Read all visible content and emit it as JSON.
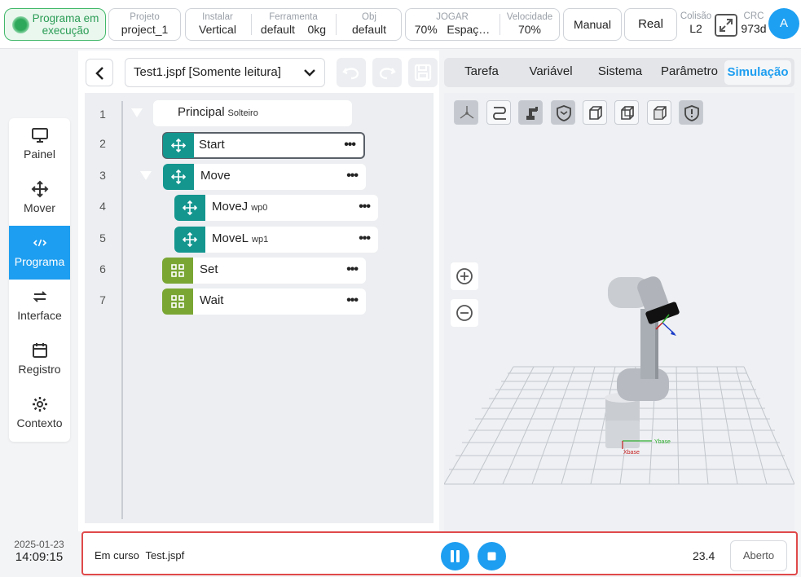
{
  "status": {
    "label": "Programa em execução",
    "color": "#2a9c55"
  },
  "header": {
    "project": {
      "label": "Projeto",
      "value": "project_1"
    },
    "install": {
      "label": "Instalar",
      "value": "Vertical"
    },
    "tool": {
      "label": "Ferramenta",
      "value": "default",
      "weight": "0kg"
    },
    "obj": {
      "label": "Obj",
      "value": "default"
    },
    "jog": {
      "label": "JOGAR",
      "value": "70%",
      "space": "Espaç…"
    },
    "speed": {
      "label": "Velocidade",
      "value": "70%"
    },
    "mode_manual": "Manual",
    "mode_real": "Real",
    "collision": {
      "label": "Colisão",
      "value": "L2"
    },
    "crc": {
      "label": "CRC",
      "value": "973d"
    },
    "avatar": "A"
  },
  "nav": {
    "items": [
      {
        "label": "Painel",
        "icon": "monitor-icon"
      },
      {
        "label": "Mover",
        "icon": "move-arrows-icon"
      },
      {
        "label": "Programa",
        "icon": "code-icon"
      },
      {
        "label": "Interface",
        "icon": "swap-icon"
      },
      {
        "label": "Registro",
        "icon": "calendar-icon"
      },
      {
        "label": "Contexto",
        "icon": "gear-icon"
      }
    ],
    "active": "Programa"
  },
  "datetime": {
    "date": "2025-01-23",
    "time": "14:09:15"
  },
  "editor": {
    "file": "Test1.jspf [Somente leitura]",
    "tree": [
      {
        "line": "1",
        "label": "Principal",
        "sub": "Solteiro",
        "type": "root"
      },
      {
        "line": "2",
        "label": "Start",
        "sub": "",
        "type": "move",
        "selected": true
      },
      {
        "line": "3",
        "label": "Move",
        "sub": "",
        "type": "move"
      },
      {
        "line": "4",
        "label": "MoveJ",
        "sub": "wp0",
        "type": "move"
      },
      {
        "line": "5",
        "label": "MoveL",
        "sub": "wp1",
        "type": "move"
      },
      {
        "line": "6",
        "label": "Set",
        "sub": "",
        "type": "grid"
      },
      {
        "line": "7",
        "label": "Wait",
        "sub": "",
        "type": "grid"
      }
    ],
    "more": "•••"
  },
  "tabs": [
    "Tarefa",
    "Variável",
    "Sistema",
    "Parâmetro",
    "Simulação"
  ],
  "active_tab": "Simulação",
  "sim": {
    "axis_x": "Xbase",
    "axis_y": "Ybase"
  },
  "run": {
    "status": "Em curso",
    "file": "Test.jspf",
    "value": "23.4",
    "open_label": "Aberto"
  },
  "colors": {
    "accent": "#1e9ef0",
    "teal": "#14968f",
    "green": "#7aa634",
    "highlight": "#e0494a"
  }
}
